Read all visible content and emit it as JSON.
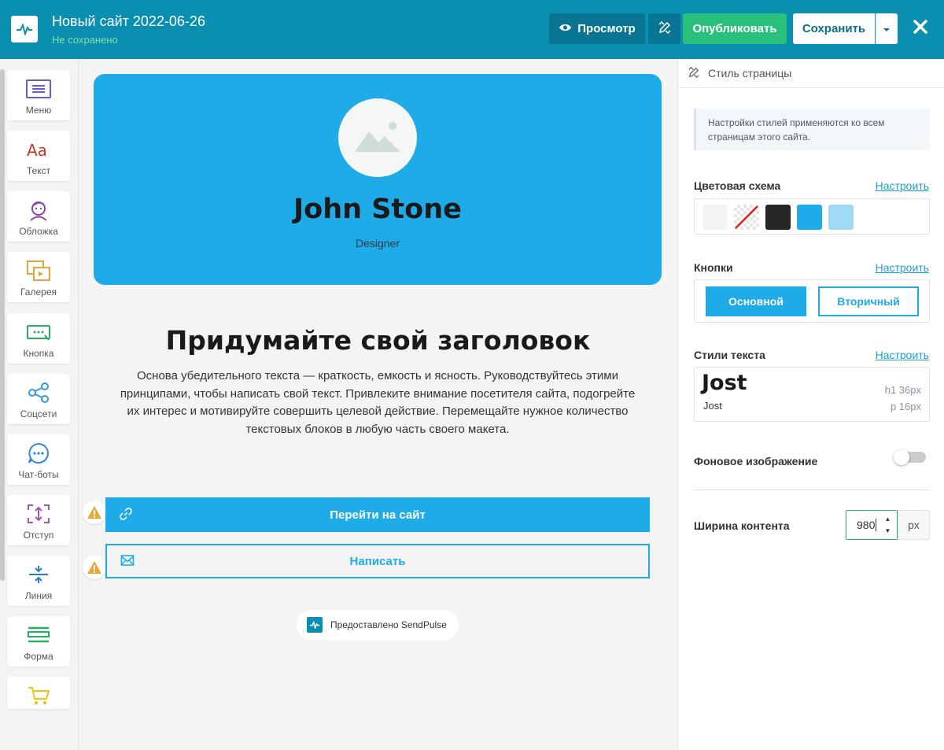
{
  "header": {
    "title": "Новый сайт 2022-06-26",
    "status": "Не сохранено",
    "preview_label": "Просмотр",
    "publish_label": "Опубликовать",
    "save_label": "Сохранить"
  },
  "toolbar": {
    "items": [
      {
        "label": "Меню",
        "icon": "menu-icon"
      },
      {
        "label": "Текст",
        "icon": "text-icon"
      },
      {
        "label": "Обложка",
        "icon": "cover-icon"
      },
      {
        "label": "Галерея",
        "icon": "gallery-icon"
      },
      {
        "label": "Кнопка",
        "icon": "button-icon"
      },
      {
        "label": "Соцсети",
        "icon": "share-icon"
      },
      {
        "label": "Чат-боты",
        "icon": "chat-icon"
      },
      {
        "label": "Отступ",
        "icon": "spacing-icon"
      },
      {
        "label": "Линия",
        "icon": "line-icon"
      },
      {
        "label": "Форма",
        "icon": "form-icon"
      },
      {
        "label": "",
        "icon": "cart-icon"
      }
    ]
  },
  "canvas": {
    "hero": {
      "name": "John Stone",
      "role": "Designer"
    },
    "headline": "Придумайте свой заголовок",
    "body": "Основа убедительного текста — краткость, емкость и ясность. Руководствуйтесь этими принципами, чтобы написать свой текст. Привлеките внимание посетителя сайта, подогрейте их интерес и мотивируйте совершить целевой действие. Перемещайте нужное количество текстовых блоков в любую часть своего макета.",
    "button_primary": "Перейти на сайт",
    "button_secondary": "Написать",
    "credit": "Предоставлено SendPulse"
  },
  "panel": {
    "title": "Стиль страницы",
    "note": "Настройки стилей применяются ко всем страницам этого сайта.",
    "color_scheme_label": "Цветовая схема",
    "configure_label": "Настроить",
    "swatches": [
      "#f4f4f4",
      "transparent",
      "#262626",
      "#1fabe8",
      "#9fdaf5"
    ],
    "buttons_label": "Кнопки",
    "button_primary": "Основной",
    "button_secondary": "Вторичный",
    "text_styles_label": "Стили текста",
    "font_big": "Jost",
    "font_small": "Jost",
    "h1_meta": "h1   36px",
    "p_meta": "p   16px",
    "bg_image_label": "Фоновое изображение",
    "bg_image_enabled": false,
    "content_width_label": "Ширина контента",
    "content_width_value": "980",
    "content_width_unit": "px"
  },
  "colors": {
    "brand": "#0b8fb0",
    "accent": "#1fabe8",
    "publish": "#28c07a"
  }
}
